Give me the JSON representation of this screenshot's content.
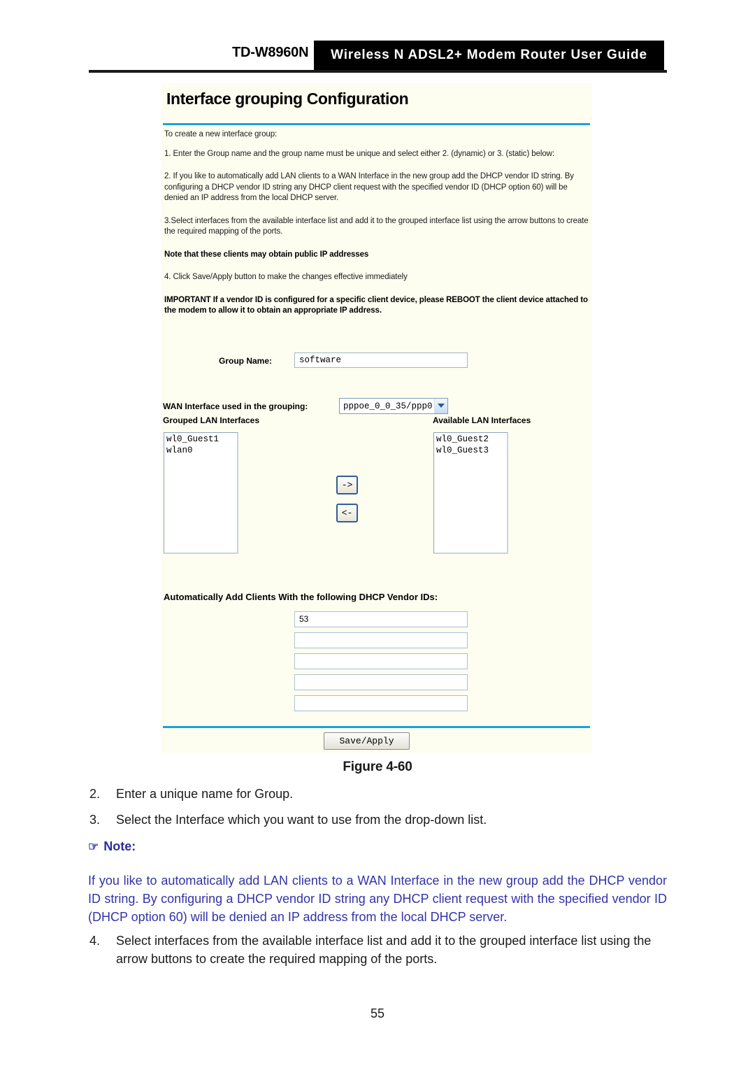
{
  "header": {
    "model": "TD-W8960N",
    "banner_title": "Wireless  N  ADSL2+  Modem  Router  User  Guide"
  },
  "figure": {
    "title": "Interface grouping Configuration",
    "intro": "To create a new interface group:",
    "step1": "1. Enter the Group name and the group name must be unique and select either 2. (dynamic) or 3. (static) below:",
    "step2": "2. If you like to automatically add LAN clients to a WAN Interface in the new group add the DHCP vendor ID string. By configuring a DHCP vendor ID string any DHCP client request with the specified vendor ID (DHCP option 60) will be denied an IP address from the local DHCP server.",
    "step3": "3.Select interfaces from the available interface list and add it to the grouped interface list using the arrow buttons to create the required mapping of the ports.",
    "note_public_ip": "Note that these clients may obtain public IP addresses",
    "step4": "4. Click Save/Apply button to make the changes effective immediately",
    "important": "IMPORTANT If a vendor ID is configured for a specific client device, please REBOOT the client device attached to the modem to allow it to obtain an appropriate IP address.",
    "group_name_label": "Group Name:",
    "group_name_value": "software",
    "wan_interface_label": "WAN Interface used in the grouping:",
    "wan_interface_value": "pppoe_0_0_35/ppp0",
    "grouped_lan_label": "Grouped LAN Interfaces",
    "available_lan_label": "Available LAN Interfaces",
    "grouped_lan_items": [
      "wl0_Guest1",
      "wlan0"
    ],
    "available_lan_items": [
      "wl0_Guest2",
      "wl0_Guest3"
    ],
    "arrow_right_label": "->",
    "arrow_left_label": "<-",
    "vendor_ids_label": "Automatically Add Clients With the following DHCP Vendor IDs:",
    "vendor_ids": [
      "53",
      "",
      "",
      "",
      ""
    ],
    "save_apply_label": "Save/Apply",
    "accent_color": "#18a3dd",
    "panel_background": "#fdfdf0"
  },
  "caption": "Figure 4-60",
  "steps": [
    {
      "marker": "2.",
      "text": "Enter a unique name for Group."
    },
    {
      "marker": "3.",
      "text": "Select the Interface which you want to use from the drop-down list."
    },
    {
      "marker": "4.",
      "text": "Select interfaces from the available interface list and add it to the grouped interface list using the arrow buttons to create the required mapping of the ports."
    }
  ],
  "note": {
    "icon": "☞",
    "label": "Note:",
    "body": "If you like to automatically add LAN clients to a WAN Interface in the new group add the DHCP vendor ID string. By configuring a DHCP vendor ID string any DHCP client request with the specified vendor ID (DHCP option 60) will be denied an IP address from the local DHCP server.",
    "color": "#3333a8"
  },
  "page_number": "55"
}
